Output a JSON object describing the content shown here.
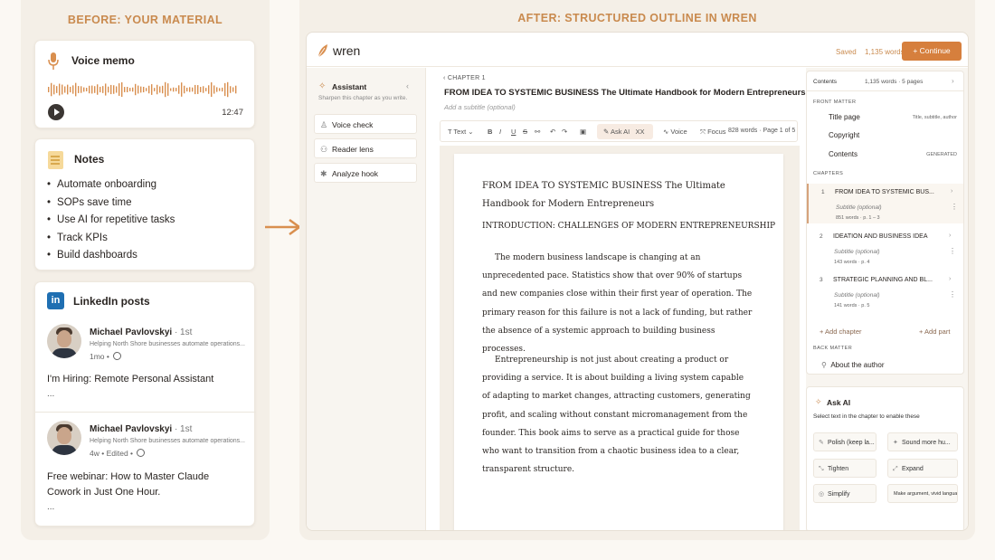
{
  "left": {
    "heading": "BEFORE: YOUR MATERIAL",
    "voice": {
      "title": "Voice memo",
      "duration": "12:47"
    },
    "notes": {
      "title": "Notes",
      "items": [
        "Automate onboarding",
        "SOPs save time",
        "Use AI for repetitive tasks",
        "Track KPIs",
        "Build dashboards"
      ]
    },
    "linkedin": {
      "title": "LinkedIn posts",
      "logo": "in",
      "posts": [
        {
          "name": "Michael Pavlovskyi",
          "degree": "· 1st",
          "subtitle": "Helping North Shore businesses automate operations...",
          "meta": "1mo •",
          "text": "I'm Hiring: Remote Personal Assistant",
          "more": "..."
        },
        {
          "name": "Michael Pavlovskyi",
          "degree": "· 1st",
          "subtitle": "Helping North Shore businesses automate operations...",
          "meta": "4w • Edited •",
          "text": "Free webinar: How to Master Claude Cowork in Just One Hour.",
          "more": "..."
        }
      ]
    }
  },
  "right": {
    "heading": "AFTER: STRUCTURED OUTLINE IN WREN",
    "app": {
      "logo": "wren",
      "saved": "Saved",
      "words": "1,135 words",
      "continue": "+ Continue"
    },
    "assistant": {
      "title": "Assistant",
      "chevron": "‹",
      "subtitle": "Sharpen this chapter as you write.",
      "tools": [
        {
          "label": "Voice check",
          "icon": "voice-check-icon"
        },
        {
          "label": "Reader lens",
          "icon": "reader-lens-icon"
        },
        {
          "label": "Analyze hook",
          "icon": "analyze-hook-icon"
        }
      ]
    },
    "editor": {
      "chapter_label": "‹  CHAPTER 1",
      "title": "FROM IDEA TO SYSTEMIC BUSINESS The Ultimate Handbook for Modern Entrepreneurs",
      "subtitle_placeholder": "Add a subtitle (optional)",
      "toolbar": {
        "text": "T Text ⌄",
        "ask_ai": "Ask AI",
        "ask_ai_shortcut": "XX",
        "voice": "Voice",
        "focus": "Focus",
        "count": "828 words · Page 1 of 5"
      },
      "page": {
        "heading": "FROM IDEA TO SYSTEMIC BUSINESS The Ultimate Handbook for Modern Entrepreneurs",
        "section": "INTRODUCTION: CHALLENGES OF MODERN ENTREPRENEURSHIP",
        "paragraphs": [
          "The modern business landscape is changing at an unprecedented pace. Statistics show that over 90% of startups and new companies close within their first year of operation. The primary reason for this failure is not a lack of funding, but rather the absence of a systemic approach to building business processes.",
          "Entrepreneurship is not just about creating a product or providing a service. It is about building a living system capable of adapting to market changes, attracting customers, generating profit, and scaling without constant micromanagement from the founder. This book aims to serve as a practical guide for those who want to transition from a chaotic business idea to a clear, transparent structure."
        ]
      }
    },
    "outline": {
      "contents_label": "Contents",
      "contents_meta": "1,135 words · 5 pages",
      "front_matter_label": "FRONT MATTER",
      "front_matter": [
        {
          "label": "Title page",
          "note": "Title, subtitle, author"
        },
        {
          "label": "Copyright",
          "note": ""
        },
        {
          "label": "Contents",
          "note": "GENERATED"
        }
      ],
      "chapters_label": "CHAPTERS",
      "chapters": [
        {
          "num": "1",
          "title": "FROM IDEA TO SYSTEMIC BUS...",
          "subtitle": "Subtitle (optional)",
          "meta": "851 words · p. 1 – 3"
        },
        {
          "num": "2",
          "title": "IDEATION AND BUSINESS IDEA",
          "subtitle": "Subtitle (optional)",
          "meta": "143 words · p. 4"
        },
        {
          "num": "3",
          "title": "STRATEGIC PLANNING AND BL...",
          "subtitle": "Subtitle (optional)",
          "meta": "141 words · p. 5"
        }
      ],
      "add_chapter": "+ Add chapter",
      "add_part": "+ Add part",
      "back_matter_label": "BACK MATTER",
      "about_author": "About the author"
    },
    "ask_ai": {
      "title": "Ask AI",
      "subtitle": "Select text in the chapter to enable these",
      "actions": [
        "Polish (keep la...",
        "Sound more hu...",
        "Tighten",
        "Expand",
        "Simplify",
        "Make argument, vivid language"
      ]
    }
  }
}
